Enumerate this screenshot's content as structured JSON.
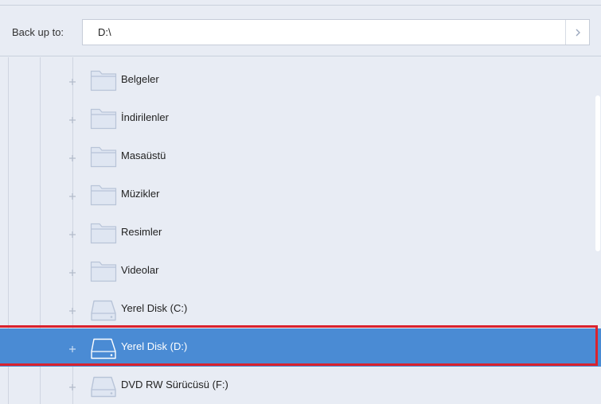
{
  "toolbar": {
    "backup_label": "Back up to:",
    "path_value": "D:\\",
    "go_icon": "chevron-right-icon"
  },
  "tree": {
    "items": [
      {
        "label": "Belgeler",
        "icon": "folder-icon",
        "selected": false
      },
      {
        "label": "İndirilenler",
        "icon": "folder-icon",
        "selected": false
      },
      {
        "label": "Masaüstü",
        "icon": "folder-icon",
        "selected": false
      },
      {
        "label": "Müzikler",
        "icon": "folder-icon",
        "selected": false
      },
      {
        "label": "Resimler",
        "icon": "folder-icon",
        "selected": false
      },
      {
        "label": "Videolar",
        "icon": "folder-icon",
        "selected": false
      },
      {
        "label": "Yerel Disk (C:)",
        "icon": "drive-icon",
        "selected": false
      },
      {
        "label": "Yerel Disk (D:)",
        "icon": "drive-icon",
        "selected": true
      },
      {
        "label": "DVD RW Sürücüsü (F:)",
        "icon": "drive-icon",
        "selected": false
      }
    ]
  },
  "colors": {
    "background": "#e8ecf4",
    "selected_row": "#4a8bd4",
    "highlight_frame": "#d9222e",
    "icon_stroke": "#b8c4d8",
    "icon_fill": "#dfe6f2"
  }
}
